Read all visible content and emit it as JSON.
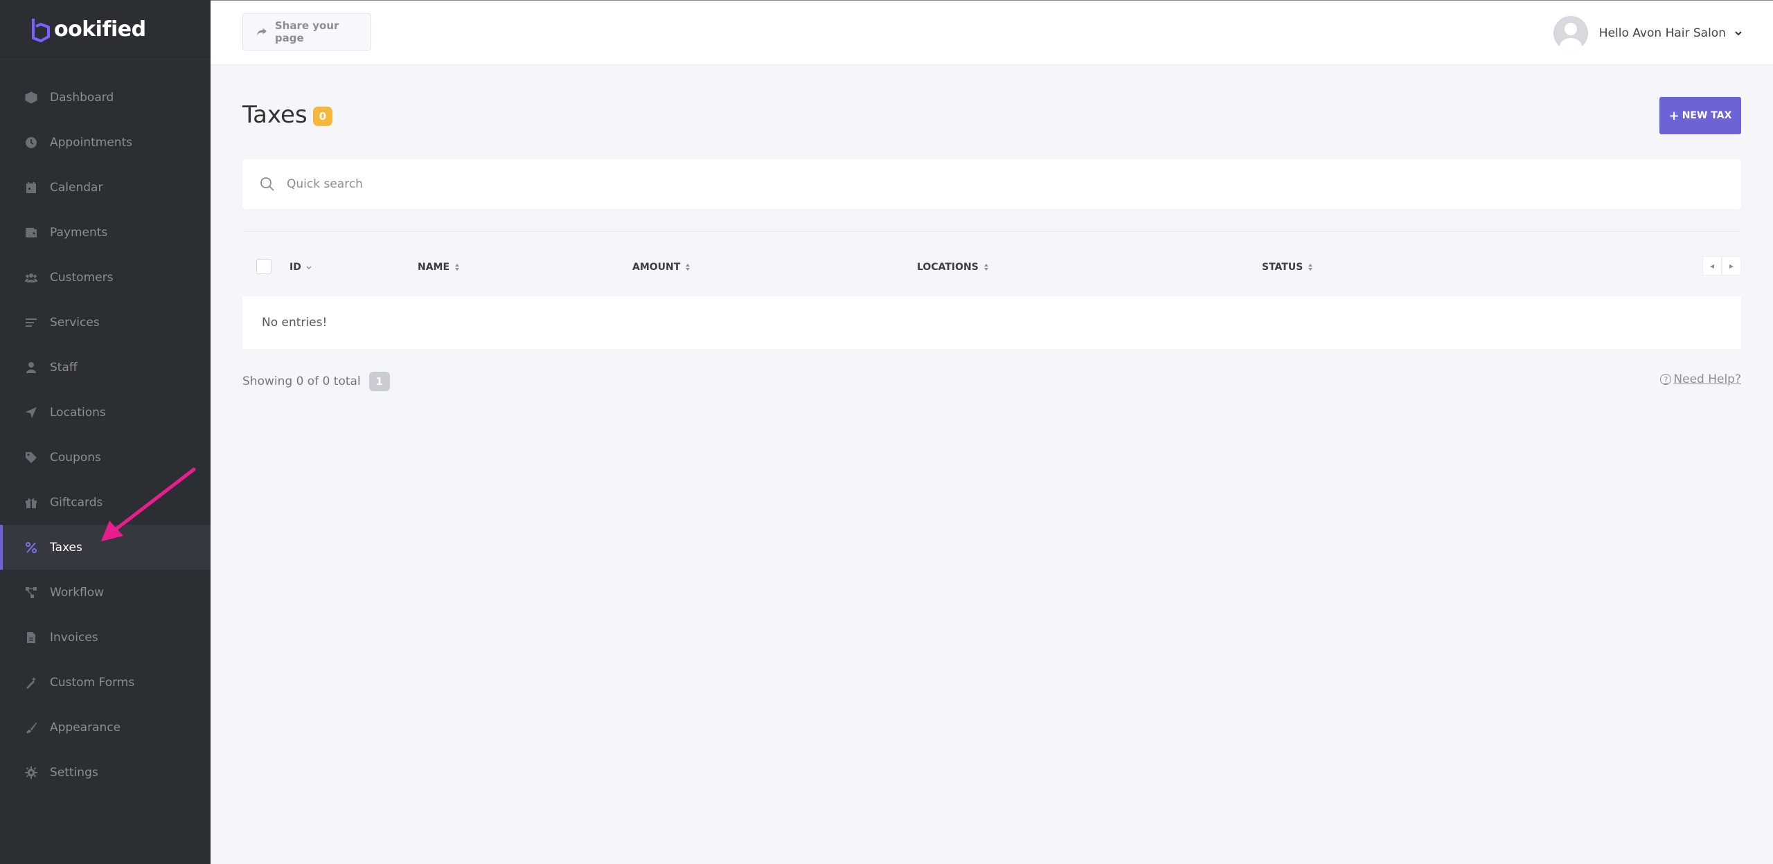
{
  "app": {
    "logo_text": "ookified",
    "accent_color": "#6c63d6",
    "sidebar_bg": "#2b2e33",
    "badge_color": "#f5b83d"
  },
  "sidebar": {
    "items": [
      {
        "label": "Dashboard",
        "icon": "cube-icon"
      },
      {
        "label": "Appointments",
        "icon": "clock-icon"
      },
      {
        "label": "Calendar",
        "icon": "calendar-icon"
      },
      {
        "label": "Payments",
        "icon": "wallet-icon"
      },
      {
        "label": "Customers",
        "icon": "users-icon"
      },
      {
        "label": "Services",
        "icon": "list-icon"
      },
      {
        "label": "Staff",
        "icon": "user-icon"
      },
      {
        "label": "Locations",
        "icon": "location-arrow-icon"
      },
      {
        "label": "Coupons",
        "icon": "tag-icon"
      },
      {
        "label": "Giftcards",
        "icon": "gift-icon"
      },
      {
        "label": "Taxes",
        "icon": "percent-icon",
        "active": true
      },
      {
        "label": "Workflow",
        "icon": "workflow-icon"
      },
      {
        "label": "Invoices",
        "icon": "file-icon"
      },
      {
        "label": "Custom Forms",
        "icon": "magic-wand-icon"
      },
      {
        "label": "Appearance",
        "icon": "brush-icon"
      },
      {
        "label": "Settings",
        "icon": "gear-icon"
      }
    ]
  },
  "header": {
    "share_label": "Share your page",
    "user_greeting": "Hello Avon Hair Salon"
  },
  "main": {
    "title": "Taxes",
    "count": "0",
    "new_button_label": "NEW TAX",
    "search_placeholder": "Quick search",
    "columns": [
      "ID",
      "NAME",
      "AMOUNT",
      "LOCATIONS",
      "STATUS"
    ],
    "empty_text": "No entries!",
    "showing_text": "Showing 0 of 0 total",
    "page_number": "1",
    "help_label": "Need Help?"
  }
}
